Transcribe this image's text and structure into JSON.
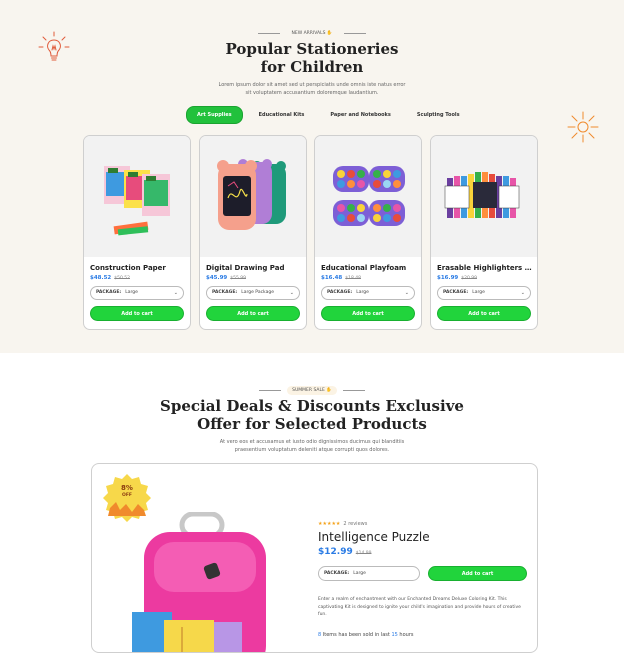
{
  "section1": {
    "eyebrow": "NEW ARRIVALS",
    "eyebrow_icon": "hand-wave-icon",
    "title_line1": "Popular Stationeries",
    "title_line2": "for Children",
    "subtitle_line1": "Lorem ipsum dolor sit amet sed ut perspiciatis unde omnis iste natus error",
    "subtitle_line2": "sit voluptatem accusantium doloremque laudantium.",
    "tabs": [
      {
        "label": "Art Supplies",
        "active": true
      },
      {
        "label": "Educational Kits",
        "active": false
      },
      {
        "label": "Paper and Notebooks",
        "active": false
      },
      {
        "label": "Sculpting Tools",
        "active": false
      }
    ],
    "products": [
      {
        "name": "Construction Paper",
        "price": "$48.52",
        "old_price": "$50.52",
        "package_label": "PACKAGE:",
        "package_value": "Large",
        "button": "Add to cart"
      },
      {
        "name": "Digital Drawing Pad",
        "price": "$45.99",
        "old_price": "$55.99",
        "package_label": "PACKAGE:",
        "package_value": "Large Package",
        "button": "Add to cart"
      },
      {
        "name": "Educational Playfoam",
        "price": "$16.48",
        "old_price": "$18.48",
        "package_label": "PACKAGE:",
        "package_value": "Large",
        "button": "Add to cart"
      },
      {
        "name": "Erasable Highlighters M...",
        "price": "$16.99",
        "old_price": "$20.99",
        "package_label": "PACKAGE:",
        "package_value": "Large",
        "button": "Add to cart"
      }
    ]
  },
  "section2": {
    "eyebrow": "SUMMER SALE",
    "eyebrow_icon": "hand-wave-icon",
    "title_line1": "Special Deals & Discounts Exclusive",
    "title_line2": "Offer for Selected Products",
    "subtitle_line1": "At vero eos et accusamus et iusto odio dignissimos ducimus qui blanditiis",
    "subtitle_line2": "praesentium voluptatum deleniti atque corrupti quos dolores.",
    "badge_percent": "8%",
    "badge_off": "OFF",
    "reviews": "2 reviews",
    "rating": 5,
    "product_name": "Intelligence Puzzle",
    "price": "$12.99",
    "old_price": "$14.99",
    "package_label": "PACKAGE:",
    "package_value": "Large",
    "button": "Add to cart",
    "description": "Enter a realm of enchantment with our Enchanted Dreams Deluxe Coloring Kit. This captivating Kit is designed to ignite your child's imagination and provide hours of creative fun.",
    "sold_count": "8",
    "sold_text": "Items has been sold in last",
    "sold_hours": "15",
    "sold_unit": "hours"
  },
  "colors": {
    "accent_green": "#21d43c",
    "price_blue": "#2a7be4",
    "cream_bg": "#f8f5ef",
    "orange": "#f08a2c"
  }
}
